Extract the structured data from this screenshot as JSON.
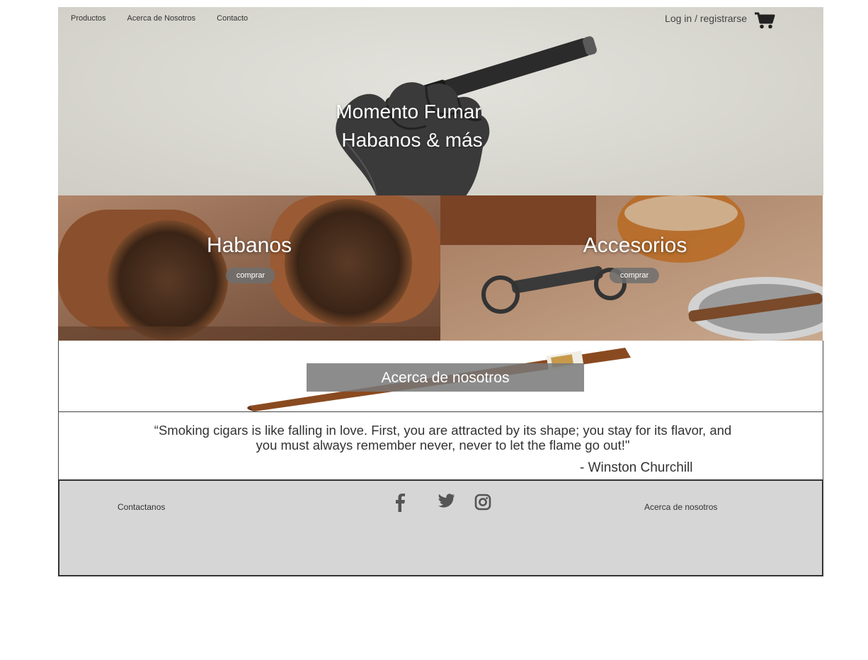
{
  "nav": {
    "items": [
      "Productos",
      "Acerca de Nosotros",
      "Contacto"
    ],
    "login": "Log in / registrarse",
    "cart_icon": "shopping-cart-icon"
  },
  "hero": {
    "title_line1": "Momento Fumar",
    "title_line2": "Habanos & más"
  },
  "cards": {
    "habanos": {
      "title": "Habanos",
      "button": "comprar"
    },
    "accesorios": {
      "title": "Accesorios",
      "button": "comprar"
    }
  },
  "about": {
    "button": "Acerca de nosotros"
  },
  "quote": {
    "text": "“Smoking cigars is like falling in love. First, you are attracted by its shape; you stay for its flavor, and you must always remember never, never to let the flame go out!\"",
    "author": "- Winston Churchill"
  },
  "footer": {
    "contact": "Contactanos",
    "about": "Acerca de nosotros",
    "social": [
      "facebook-icon",
      "twitter-icon",
      "instagram-icon"
    ]
  },
  "colors": {
    "button_gray": "#6e6e6e",
    "footer_bg": "#d6d6d6",
    "tobacco_brown": "#7a4a2a"
  }
}
